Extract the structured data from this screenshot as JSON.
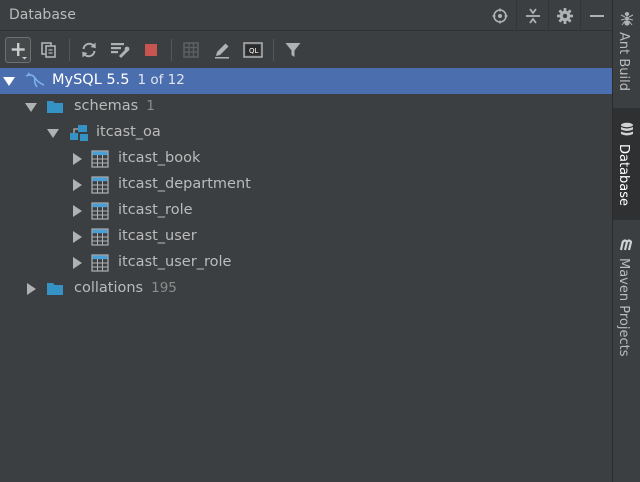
{
  "panel": {
    "title": "Database"
  },
  "side_tabs": [
    {
      "label": "Ant Build",
      "icon": "ant-icon"
    },
    {
      "label": "Database",
      "icon": "database-icon"
    },
    {
      "label": "Maven Projects",
      "icon": "maven-icon"
    }
  ],
  "toolbar": {
    "sql_glyph": "QL",
    "icons": [
      "add-datasource-icon",
      "copy-icon",
      "refresh-icon",
      "sync-schema-icon",
      "stop-icon",
      "table-editor-icon",
      "edit-icon",
      "sql-console-icon",
      "filter-icon"
    ]
  },
  "tree": {
    "datasource": {
      "label": "MySQL 5.5",
      "count": "1 of 12"
    },
    "schemas": {
      "label": "schemas",
      "count": "1"
    },
    "schema": {
      "label": "itcast_oa"
    },
    "tables": [
      {
        "label": "itcast_book"
      },
      {
        "label": "itcast_department"
      },
      {
        "label": "itcast_role"
      },
      {
        "label": "itcast_user"
      },
      {
        "label": "itcast_user_role"
      }
    ],
    "collations": {
      "label": "collations",
      "count": "195"
    }
  },
  "colors": {
    "background": "#3c3f41",
    "selection": "#4b6eaf",
    "folder": "#3592c4",
    "stop": "#c75450"
  }
}
